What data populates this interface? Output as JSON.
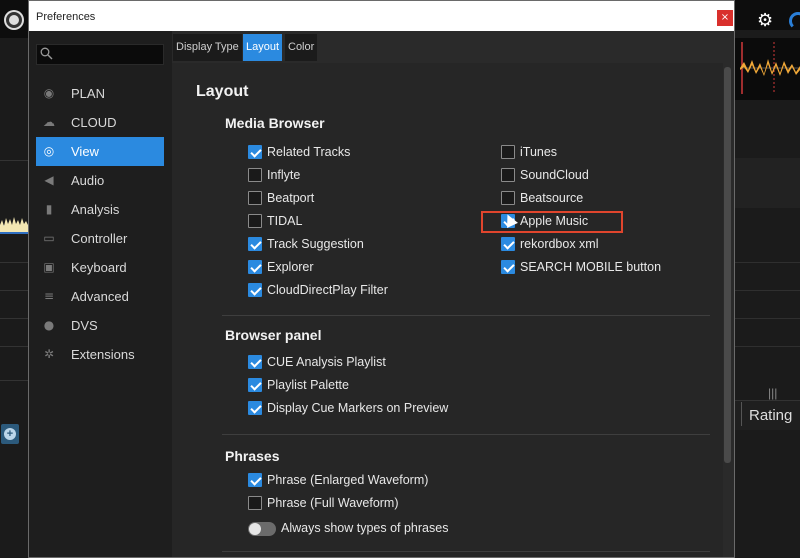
{
  "background": {
    "right_column_header": "Rating"
  },
  "dialog": {
    "title": "Preferences",
    "close_glyph": "×",
    "search": {
      "placeholder": "",
      "value": ""
    },
    "nav": [
      {
        "label": "PLAN",
        "icon": "plan-icon",
        "active": false
      },
      {
        "label": "CLOUD",
        "icon": "cloud-icon",
        "active": false
      },
      {
        "label": "View",
        "icon": "eye-icon",
        "active": true
      },
      {
        "label": "Audio",
        "icon": "speaker-icon",
        "active": false
      },
      {
        "label": "Analysis",
        "icon": "waveform-icon",
        "active": false
      },
      {
        "label": "Controller",
        "icon": "controller-icon",
        "active": false
      },
      {
        "label": "Keyboard",
        "icon": "keyboard-icon",
        "active": false
      },
      {
        "label": "Advanced",
        "icon": "list-icon",
        "active": false
      },
      {
        "label": "DVS",
        "icon": "vinyl-icon",
        "active": false
      },
      {
        "label": "Extensions",
        "icon": "extensions-icon",
        "active": false
      }
    ],
    "tabs": [
      {
        "label": "Display Type",
        "active": false
      },
      {
        "label": "Layout",
        "active": true
      },
      {
        "label": "Color",
        "active": false
      }
    ],
    "layout": {
      "heading": "Layout",
      "media_browser": {
        "heading": "Media Browser",
        "left": [
          {
            "label": "Related Tracks",
            "checked": true
          },
          {
            "label": "Inflyte",
            "checked": false
          },
          {
            "label": "Beatport",
            "checked": false
          },
          {
            "label": "TIDAL",
            "checked": false
          },
          {
            "label": "Track Suggestion",
            "checked": true
          },
          {
            "label": "Explorer",
            "checked": true
          },
          {
            "label": "CloudDirectPlay Filter",
            "checked": true
          }
        ],
        "right": [
          {
            "label": "iTunes",
            "checked": false
          },
          {
            "label": "SoundCloud",
            "checked": false
          },
          {
            "label": "Beatsource",
            "checked": false
          },
          {
            "label": "Apple Music",
            "checked": true
          },
          {
            "label": "rekordbox xml",
            "checked": true
          },
          {
            "label": "SEARCH MOBILE button",
            "checked": true
          }
        ]
      },
      "browser_panel": {
        "heading": "Browser panel",
        "options": [
          {
            "label": "CUE Analysis Playlist",
            "checked": true
          },
          {
            "label": "Playlist Palette",
            "checked": true
          },
          {
            "label": "Display Cue Markers on Preview",
            "checked": true
          }
        ]
      },
      "phrases": {
        "heading": "Phrases",
        "options": [
          {
            "label": "Phrase (Enlarged Waveform)",
            "checked": true
          },
          {
            "label": "Phrase (Full Waveform)",
            "checked": false
          }
        ],
        "toggle": {
          "label": "Always show types of phrases",
          "on": false
        }
      }
    }
  },
  "colors": {
    "accent": "#2b8ae0",
    "highlight": "#e0452d",
    "close": "#d9302c"
  }
}
